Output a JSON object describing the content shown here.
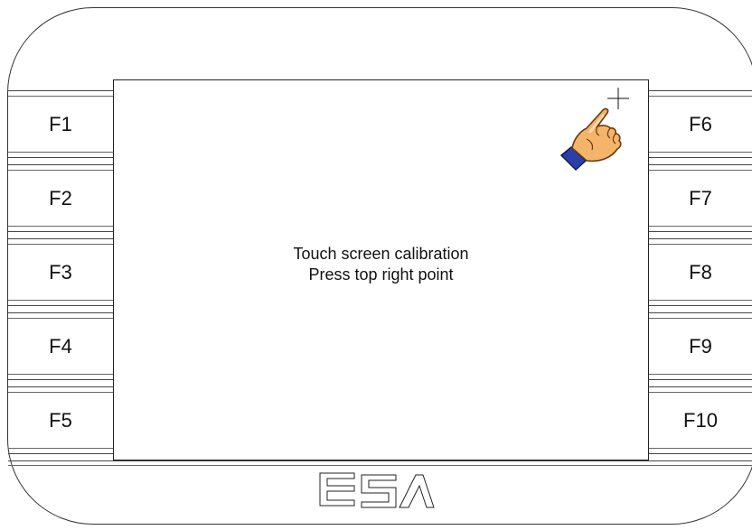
{
  "device": {
    "logo_text": "ESA"
  },
  "left_keys": [
    "F1",
    "F2",
    "F3",
    "F4",
    "F5"
  ],
  "right_keys": [
    "F6",
    "F7",
    "F8",
    "F9",
    "F10"
  ],
  "screen": {
    "line1": "Touch screen calibration",
    "line2": "Press top right point"
  },
  "icons": {
    "pointer": "pointing-hand-icon",
    "target": "crosshair-icon"
  },
  "colors": {
    "hand_skin": "#f4b46a",
    "hand_outline": "#6b3a12",
    "cuff": "#2a3fa8"
  }
}
